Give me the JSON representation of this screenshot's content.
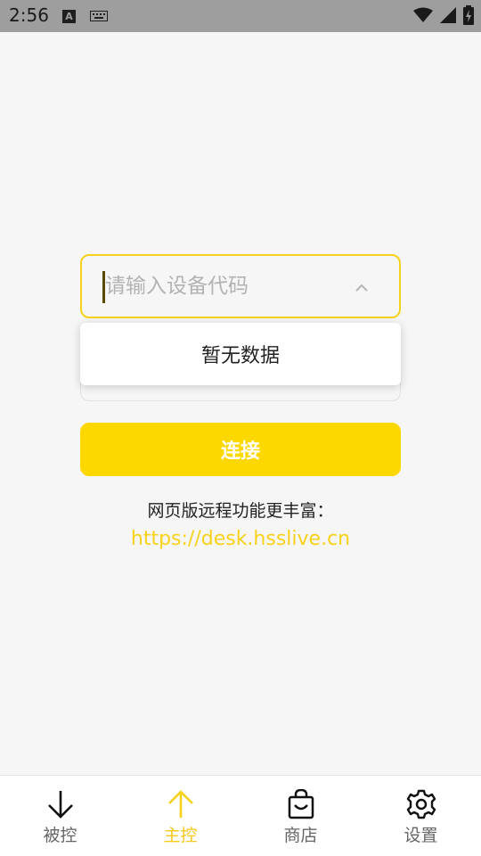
{
  "status_bar": {
    "time": "2:56",
    "keyboard_indicator": "A"
  },
  "device_field": {
    "placeholder": "请输入设备代码",
    "value": ""
  },
  "dropdown": {
    "empty_text": "暂无数据"
  },
  "connect_button": {
    "label": "连接"
  },
  "web_promo": {
    "text": "网页版远程功能更丰富：",
    "link": "https://desk.hsslive.cn"
  },
  "bottom_nav": {
    "items": [
      {
        "label": "被控",
        "icon": "arrow-down-icon",
        "active": false
      },
      {
        "label": "主控",
        "icon": "arrow-up-icon",
        "active": true
      },
      {
        "label": "商店",
        "icon": "shopping-bag-icon",
        "active": false
      },
      {
        "label": "设置",
        "icon": "gear-icon",
        "active": false
      }
    ]
  },
  "colors": {
    "accent": "#fdd700",
    "link": "#f8d21a",
    "status_bar": "#9e9e9e",
    "background": "#f6f6f6"
  }
}
